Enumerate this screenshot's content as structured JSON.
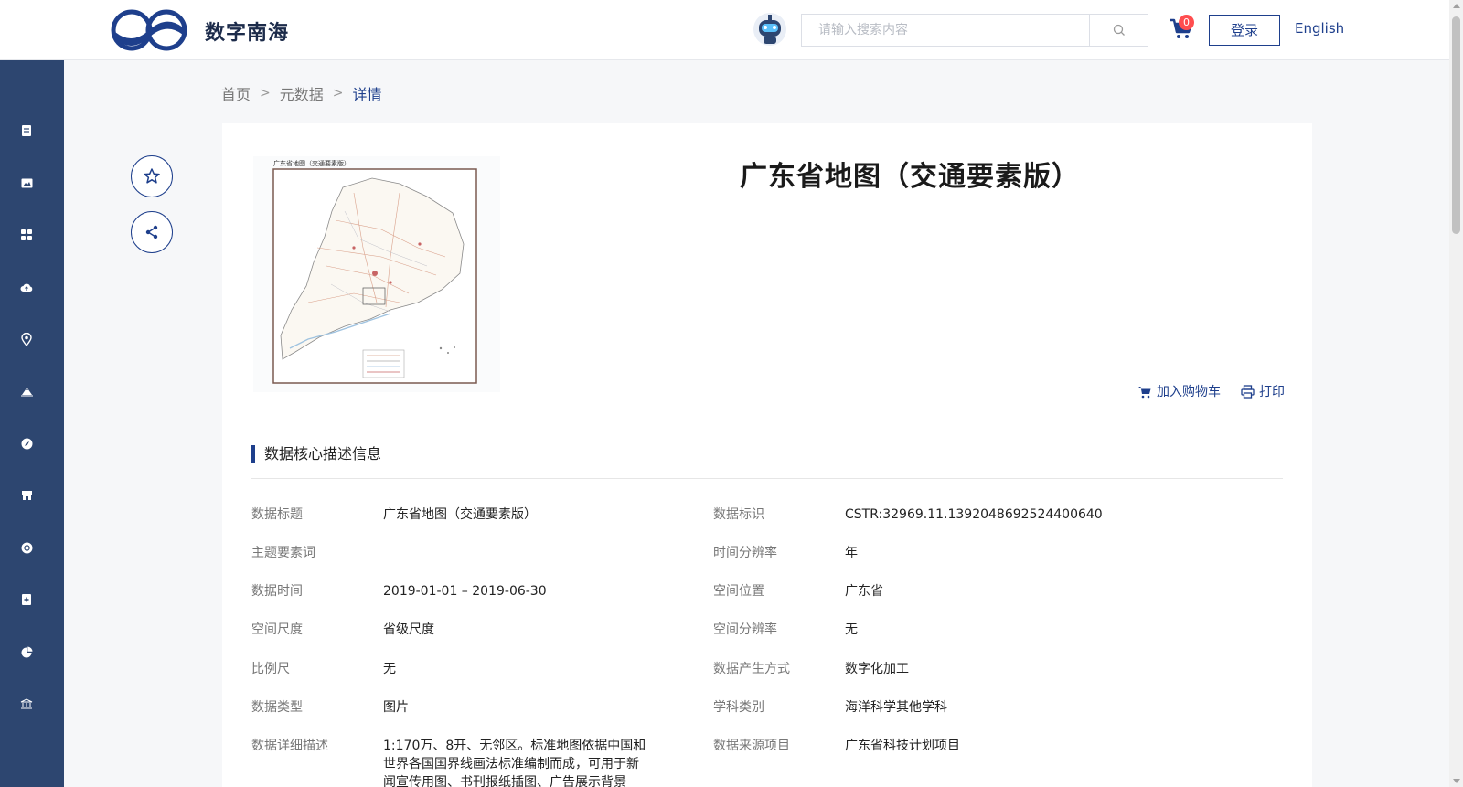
{
  "header": {
    "brand": "数字南海",
    "search_placeholder": "请输入搜索内容",
    "cart_count": "0",
    "login_label": "登录",
    "language_label": "English"
  },
  "sidebar": {
    "icons": [
      "document-icon",
      "image-icon",
      "grid-icon",
      "cloud-upload-icon",
      "location-pin-icon",
      "terrain-icon",
      "compass-icon",
      "store-icon",
      "globe-icon",
      "add-document-icon",
      "pie-chart-icon",
      "library-icon"
    ]
  },
  "breadcrumb": {
    "items": [
      "首页",
      "元数据",
      "详情"
    ]
  },
  "detail": {
    "title": "广东省地图（交通要素版）",
    "thumbnail_caption": "广东省地图（交通要素版）",
    "add_to_cart_label": "加入购物车",
    "print_label": "打印"
  },
  "section": {
    "title": "数据核心描述信息"
  },
  "fields": [
    {
      "label": "数据标题",
      "value": "广东省地图（交通要素版）"
    },
    {
      "label": "数据标识",
      "value": "CSTR:32969.11.1392048692524400640"
    },
    {
      "label": "主题要素词",
      "value": ""
    },
    {
      "label": "时间分辨率",
      "value": "年"
    },
    {
      "label": "数据时间",
      "value": "2019-01-01 – 2019-06-30"
    },
    {
      "label": "空间位置",
      "value": "广东省"
    },
    {
      "label": "空间尺度",
      "value": "省级尺度"
    },
    {
      "label": "空间分辨率",
      "value": "无"
    },
    {
      "label": "比例尺",
      "value": "无"
    },
    {
      "label": "数据产生方式",
      "value": "数字化加工"
    },
    {
      "label": "数据类型",
      "value": "图片"
    },
    {
      "label": "学科类别",
      "value": "海洋科学其他学科"
    },
    {
      "label": "数据详细描述",
      "value": "1:170万、8开、无邻区。标准地图依据中国和世界各国国界线画法标准编制而成，可用于新闻宣传用图、书刊报纸插图、广告展示背景"
    },
    {
      "label": "数据来源项目",
      "value": "广东省科技计划项目"
    }
  ],
  "colors": {
    "primary": "#1e3f8c",
    "sidebar": "#2d4670",
    "badge": "#ff4d4f"
  }
}
